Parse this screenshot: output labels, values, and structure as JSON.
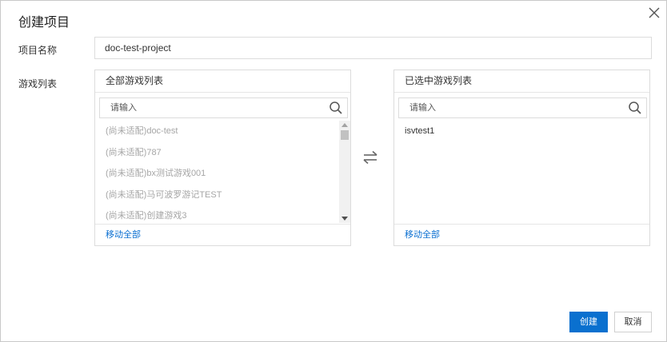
{
  "dialog": {
    "title": "创建项目",
    "close_icon": "close-icon"
  },
  "form": {
    "project_name_label": "项目名称",
    "project_name_value": "doc-test-project",
    "game_list_label": "游戏列表"
  },
  "left_panel": {
    "header": "全部游戏列表",
    "search_placeholder": "请输入",
    "items": [
      {
        "label": "(尚未适配)doc-test",
        "disabled": true
      },
      {
        "label": "(尚未适配)787",
        "disabled": true
      },
      {
        "label": "(尚未适配)bx测试游戏001",
        "disabled": true
      },
      {
        "label": "(尚未适配)马可波罗游记TEST",
        "disabled": true
      },
      {
        "label": "(尚未适配)创建游戏3",
        "disabled": true
      }
    ],
    "footer_action": "移动全部"
  },
  "right_panel": {
    "header": "已选中游戏列表",
    "search_placeholder": "请输入",
    "items": [
      {
        "label": "isvtest1",
        "disabled": false
      }
    ],
    "footer_action": "移动全部"
  },
  "transfer_icon": "swap-arrows-icon",
  "buttons": {
    "create": "创建",
    "cancel": "取消"
  },
  "colors": {
    "primary": "#0a70cf",
    "link": "#0a6fd1",
    "disabled_text": "#a6a6a6"
  }
}
